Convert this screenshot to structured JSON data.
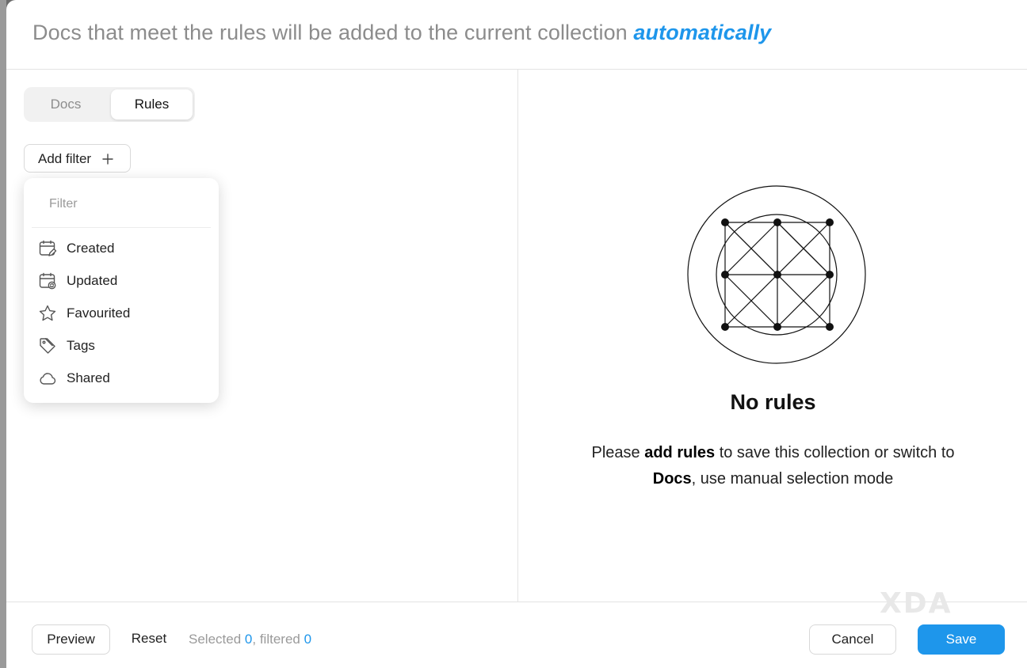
{
  "header": {
    "title": "Docs that meet the rules will be added to the current collection",
    "accent": "automatically"
  },
  "tabs": [
    {
      "label": "Docs",
      "active": false
    },
    {
      "label": "Rules",
      "active": true
    }
  ],
  "add_filter": {
    "label": "Add filter",
    "icon": "plus-icon"
  },
  "filter_menu": {
    "search_placeholder": "Filter",
    "items": [
      {
        "label": "Created",
        "icon": "calendar-edit-icon"
      },
      {
        "label": "Updated",
        "icon": "calendar-refresh-icon"
      },
      {
        "label": "Favourited",
        "icon": "star-icon"
      },
      {
        "label": "Tags",
        "icon": "tag-icon"
      },
      {
        "label": "Shared",
        "icon": "cloud-icon"
      }
    ]
  },
  "empty_state": {
    "title": "No rules",
    "line1_pre": "Please ",
    "line1_bold": "add rules",
    "line1_post": " to save this collection or switch to",
    "line2_bold": "Docs",
    "line2_post": ", use manual selection mode"
  },
  "footer": {
    "preview_label": "Preview",
    "reset_label": "Reset",
    "selected_label": "Selected",
    "selected_count": "0",
    "filtered_label": "filtered",
    "filtered_count": "0",
    "cancel_label": "Cancel",
    "save_label": "Save"
  },
  "watermark": "XDA",
  "colors": {
    "accent": "#1e96eb",
    "muted_text": "#8c8c8c",
    "border": "#e3e3e3"
  }
}
